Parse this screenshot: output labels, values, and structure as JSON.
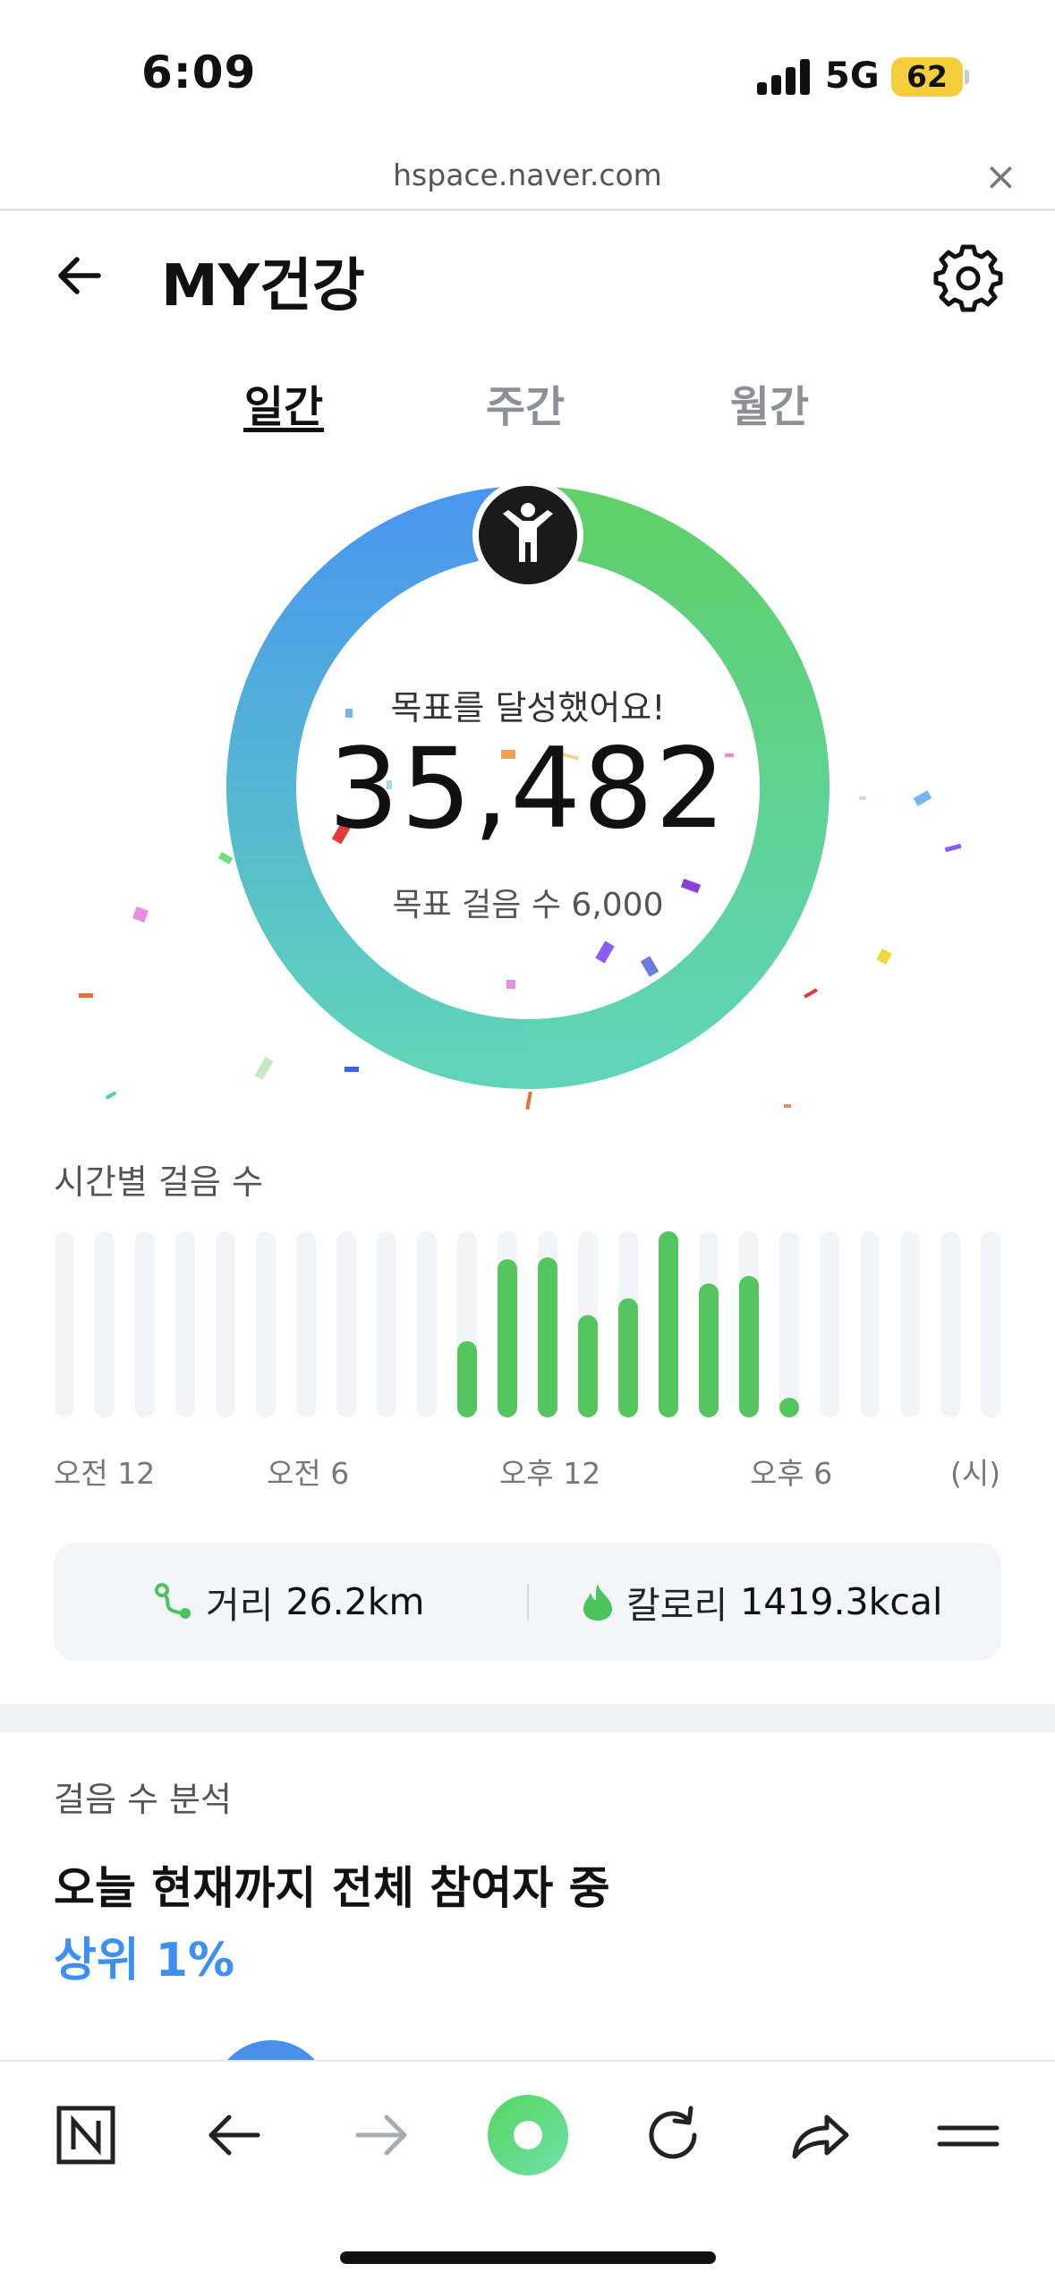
{
  "status_bar": {
    "time": "6:09",
    "network": "5G",
    "battery": "62"
  },
  "browser": {
    "url": "hspace.naver.com",
    "close_glyph": "×"
  },
  "header": {
    "title": "MY건강",
    "back_icon": "back-arrow-icon",
    "settings_icon": "gear-icon"
  },
  "tabs": [
    {
      "label": "일간",
      "active": true
    },
    {
      "label": "주간",
      "active": false
    },
    {
      "label": "월간",
      "active": false
    }
  ],
  "progress": {
    "message": "목표를 달성했어요!",
    "steps": "35,482",
    "goal_label": "목표 걸음 수 6,000",
    "fraction_of_goal": 1.0,
    "colors": {
      "start": "#4a98ee",
      "end": "#5fd07a"
    }
  },
  "hourly": {
    "title": "시간별 걸음 수",
    "axis_labels": [
      "오전 12",
      "오전 6",
      "오후 12",
      "오후 6",
      "(시)"
    ],
    "chart_data": {
      "type": "bar",
      "categories": [
        "0",
        "1",
        "2",
        "3",
        "4",
        "5",
        "6",
        "7",
        "8",
        "9",
        "10",
        "11",
        "12",
        "13",
        "14",
        "15",
        "16",
        "17",
        "18",
        "19",
        "20",
        "21",
        "22",
        "23"
      ],
      "values": [
        0,
        0,
        0,
        0,
        0,
        0,
        0,
        0,
        0,
        0,
        0.41,
        0.85,
        0.86,
        0.55,
        0.64,
        1.0,
        0.72,
        0.76,
        0.05,
        0,
        0,
        0,
        0,
        0
      ],
      "value_unit": "fraction of max hourly bar",
      "ylim": [
        0,
        1
      ],
      "bar_color": "#55c65f",
      "track_color": "#f3f4f7"
    }
  },
  "stats": {
    "distance_label": "거리",
    "distance_value": "26.2km",
    "calorie_label": "칼로리",
    "calorie_value": "1419.3kcal",
    "distance_icon": "route-icon",
    "calorie_icon": "flame-icon"
  },
  "analysis": {
    "label": "걸음 수 분석",
    "line1": "오늘 현재까지 전체 참여자 중",
    "line2": "상위 1%",
    "accent_color": "#3d8ff0"
  },
  "toolbar": {
    "items": [
      "naver-home-icon",
      "back-icon",
      "forward-icon",
      "green-dot-icon",
      "reload-icon",
      "share-icon",
      "menu-icon"
    ]
  }
}
